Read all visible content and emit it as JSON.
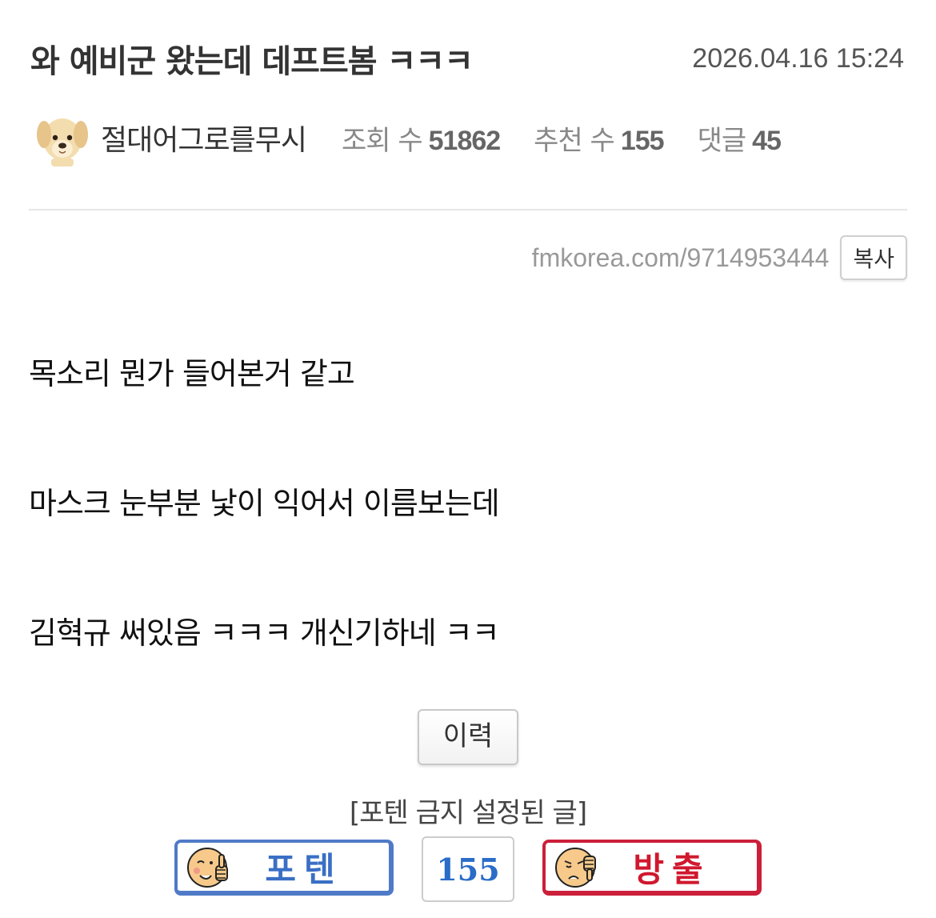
{
  "post": {
    "title": "와 예비군 왔는데 데프트봄 ㅋㅋㅋ",
    "date": "2026.04.16 15:24",
    "author": "절대어그로를무시",
    "views_label": "조회 수",
    "views": "51862",
    "recommend_label": "추천 수",
    "recommend": "155",
    "comments_label": "댓글",
    "comments": "45",
    "url": "fmkorea.com/9714953444",
    "copy_label": "복사",
    "body": [
      "목소리 뭔가 들어본거 같고",
      "마스크 눈부분 낯이 익어서 이름보는데",
      "김혁규 써있음 ㅋㅋㅋ 개신기하네 ㅋㅋ"
    ],
    "history_label": "이력",
    "notice": "[포텐 금지 설정된 글]"
  },
  "votes": {
    "up_label": "포텐",
    "count": "155",
    "down_label": "방출",
    "up_color": "#4f7ac7",
    "down_color": "#cc1f3a"
  },
  "icons": {
    "avatar": "puppy-avatar-icon",
    "up": "thumbs-up-face-icon",
    "down": "thumbs-down-face-icon"
  }
}
